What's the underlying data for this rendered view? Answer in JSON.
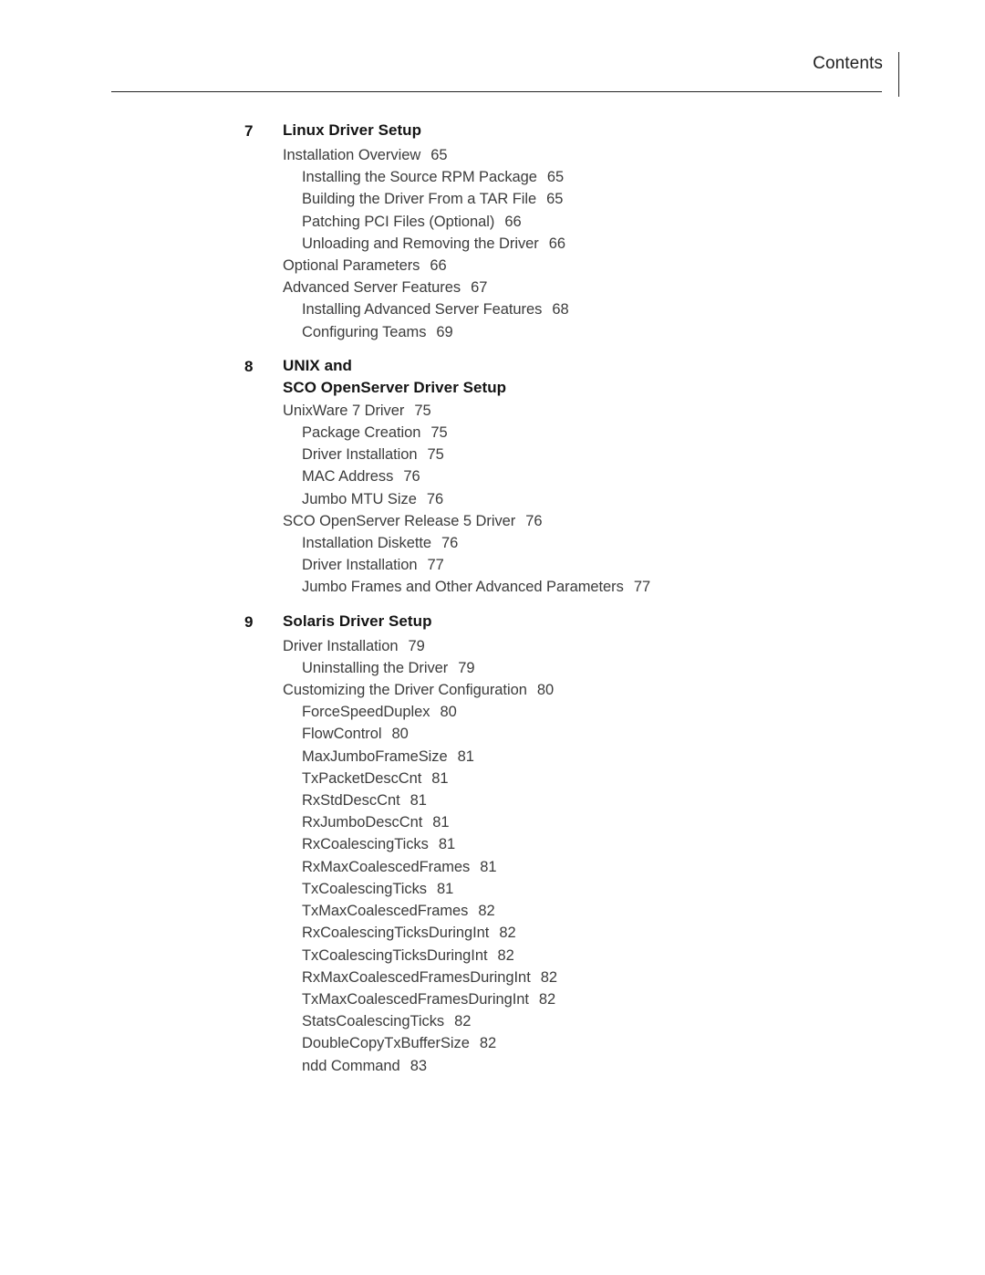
{
  "header": {
    "title": "Contents"
  },
  "chapters": [
    {
      "number": "7",
      "title_lines": [
        "Linux Driver Setup"
      ],
      "entries": [
        {
          "level": 1,
          "text": "Installation Overview",
          "page": "65"
        },
        {
          "level": 2,
          "text": "Installing the Source RPM Package",
          "page": "65"
        },
        {
          "level": 2,
          "text": "Building the Driver From a TAR File",
          "page": "65"
        },
        {
          "level": 2,
          "text": "Patching PCI Files (Optional)",
          "page": "66"
        },
        {
          "level": 2,
          "text": "Unloading and Removing the Driver",
          "page": "66"
        },
        {
          "level": 1,
          "text": "Optional Parameters",
          "page": "66"
        },
        {
          "level": 1,
          "text": "Advanced Server Features",
          "page": "67"
        },
        {
          "level": 2,
          "text": "Installing Advanced Server Features",
          "page": "68"
        },
        {
          "level": 2,
          "text": "Configuring Teams",
          "page": "69"
        }
      ]
    },
    {
      "number": "8",
      "title_lines": [
        "UNIX and",
        "SCO OpenServer Driver Setup"
      ],
      "entries": [
        {
          "level": 1,
          "text": "UnixWare 7 Driver",
          "page": "75"
        },
        {
          "level": 2,
          "text": "Package Creation",
          "page": "75"
        },
        {
          "level": 2,
          "text": "Driver Installation",
          "page": "75"
        },
        {
          "level": 2,
          "text": "MAC Address",
          "page": "76"
        },
        {
          "level": 2,
          "text": "Jumbo MTU Size",
          "page": "76"
        },
        {
          "level": 1,
          "text": "SCO OpenServer Release 5 Driver",
          "page": "76"
        },
        {
          "level": 2,
          "text": "Installation Diskette",
          "page": "76"
        },
        {
          "level": 2,
          "text": "Driver Installation",
          "page": "77"
        },
        {
          "level": 2,
          "text": "Jumbo Frames and Other Advanced Parameters",
          "page": "77"
        }
      ]
    },
    {
      "number": "9",
      "title_lines": [
        "Solaris Driver Setup"
      ],
      "entries": [
        {
          "level": 1,
          "text": "Driver Installation",
          "page": "79"
        },
        {
          "level": 2,
          "text": "Uninstalling the Driver",
          "page": "79"
        },
        {
          "level": 1,
          "text": "Customizing the Driver Configuration",
          "page": "80"
        },
        {
          "level": 2,
          "text": "ForceSpeedDuplex",
          "page": "80"
        },
        {
          "level": 2,
          "text": "FlowControl",
          "page": "80"
        },
        {
          "level": 2,
          "text": "MaxJumboFrameSize",
          "page": "81"
        },
        {
          "level": 2,
          "text": "TxPacketDescCnt",
          "page": "81"
        },
        {
          "level": 2,
          "text": "RxStdDescCnt",
          "page": "81"
        },
        {
          "level": 2,
          "text": "RxJumboDescCnt",
          "page": "81"
        },
        {
          "level": 2,
          "text": "RxCoalescingTicks",
          "page": "81"
        },
        {
          "level": 2,
          "text": "RxMaxCoalescedFrames",
          "page": "81"
        },
        {
          "level": 2,
          "text": "TxCoalescingTicks",
          "page": "81"
        },
        {
          "level": 2,
          "text": "TxMaxCoalescedFrames",
          "page": "82"
        },
        {
          "level": 2,
          "text": "RxCoalescingTicksDuringInt",
          "page": "82"
        },
        {
          "level": 2,
          "text": "TxCoalescingTicksDuringInt",
          "page": "82"
        },
        {
          "level": 2,
          "text": "RxMaxCoalescedFramesDuringInt",
          "page": "82"
        },
        {
          "level": 2,
          "text": "TxMaxCoalescedFramesDuringInt",
          "page": "82"
        },
        {
          "level": 2,
          "text": "StatsCoalescingTicks",
          "page": "82"
        },
        {
          "level": 2,
          "text": "DoubleCopyTxBufferSize",
          "page": "82"
        },
        {
          "level": 2,
          "text": "ndd Command",
          "page": "83"
        }
      ]
    }
  ]
}
